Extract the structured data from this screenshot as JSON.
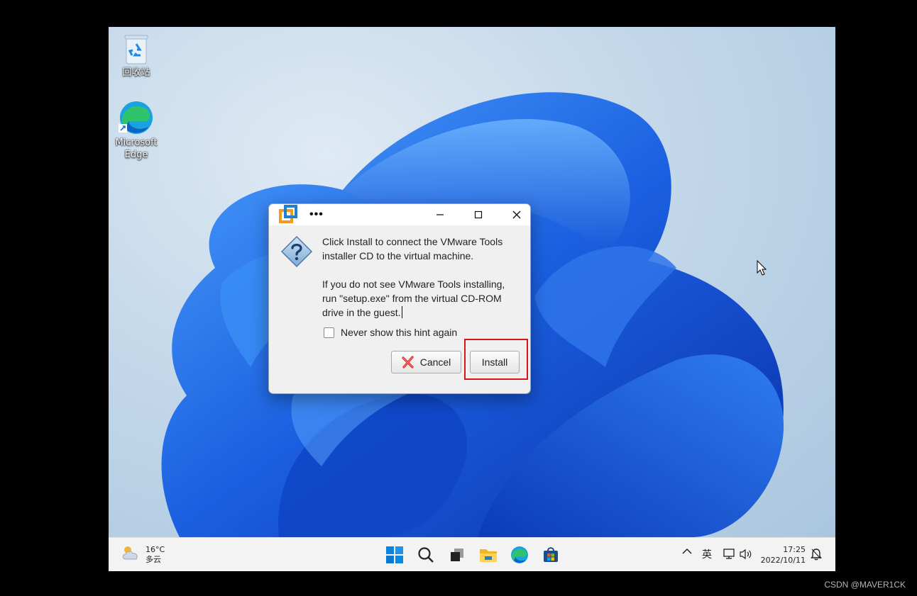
{
  "desktop": {
    "icons": [
      {
        "label": "回收站"
      },
      {
        "label": "Microsoft Edge"
      }
    ]
  },
  "dialog": {
    "title": "•••",
    "message_1": "Click Install to connect the VMware Tools installer CD to the virtual machine.",
    "message_2": "If you do not see VMware Tools installing, run \"setup.exe\" from the virtual CD-ROM drive in the guest.",
    "checkbox_label": "Never show this hint again",
    "checkbox_checked": false,
    "cancel_label": "Cancel",
    "install_label": "Install",
    "highlight_color": "#d9161e"
  },
  "taskbar": {
    "weather_temp": "16°C",
    "weather_desc": "多云",
    "pinned": [
      "start-icon",
      "search-icon",
      "task-view-icon",
      "file-explorer-icon",
      "edge-icon",
      "store-icon"
    ],
    "tray_ime": "英",
    "clock_time": "17:25",
    "clock_date": "2022/10/11"
  },
  "watermark": "CSDN @MAVER1CK",
  "colors": {
    "accent": "#0067c0",
    "wallpaper_blue": "#1a5fe0"
  }
}
